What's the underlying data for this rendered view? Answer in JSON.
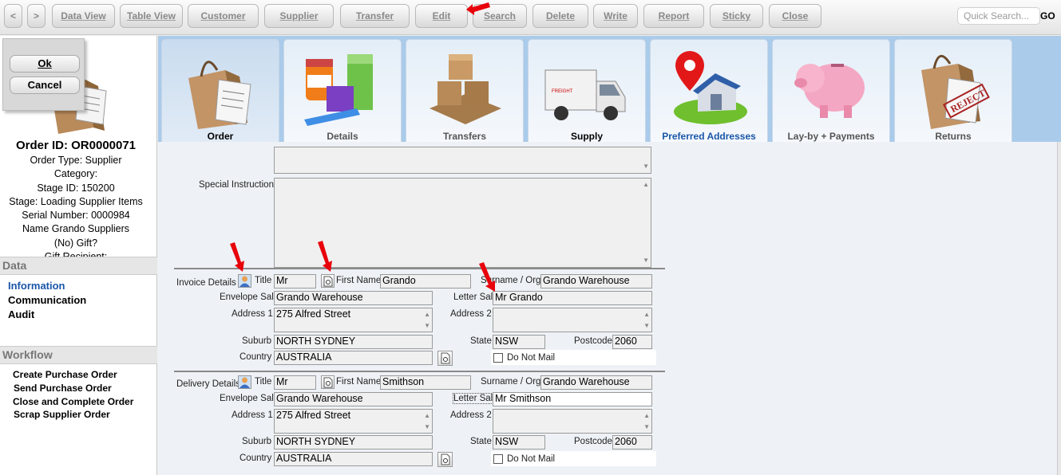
{
  "toolbar": {
    "back": "<",
    "forward": ">",
    "buttons": [
      "Data View",
      "Table View",
      "Customer",
      "Supplier",
      "Transfer",
      "Edit",
      "Search",
      "Delete",
      "Write",
      "Report",
      "Sticky",
      "Close"
    ],
    "quick_search_placeholder": "Quick Search...",
    "go": "GO"
  },
  "dialog": {
    "ok": "Ok",
    "cancel": "Cancel"
  },
  "order": {
    "id": "Order ID: OR0000071",
    "lines": [
      "Order Type: Supplier",
      "Category:",
      "Stage ID: 150200",
      "Stage: Loading Supplier Items",
      "Serial Number: 0000984",
      "Name Grando Suppliers",
      "(No) Gift?",
      "Gift Recipient:"
    ]
  },
  "data_section": {
    "title": "Data",
    "items": [
      "Information",
      "Communication",
      "Audit"
    ]
  },
  "workflow_section": {
    "title": "Workflow",
    "items": [
      "Create Purchase Order",
      "Send Purchase Order",
      "Close and Complete Order",
      "Scrap Supplier Order"
    ]
  },
  "tabs": [
    {
      "label": "Order",
      "icon": "shopping-bag-icon"
    },
    {
      "label": "Details",
      "icon": "products-icon"
    },
    {
      "label": "Transfers",
      "icon": "pallet-boxes-icon"
    },
    {
      "label": "Supply",
      "icon": "delivery-truck-icon"
    },
    {
      "label": "Preferred Addresses",
      "icon": "house-pin-icon"
    },
    {
      "label": "Lay-by + Payments",
      "icon": "piggy-bank-icon"
    },
    {
      "label": "Returns",
      "icon": "reject-bag-icon"
    }
  ],
  "form": {
    "special_instructions_label": "Special Instructions",
    "invoice": {
      "section_label": "Invoice Details",
      "title_label": "Title",
      "title": "Mr",
      "first_name_label": "First Name",
      "first_name": "Grando",
      "surname_label": "Surname / Org",
      "surname": "Grando Warehouse",
      "envelope_sal_label": "Envelope Sal",
      "envelope_sal": "Grando Warehouse",
      "letter_sal_label": "Letter Sal",
      "letter_sal": "Mr Grando",
      "address1_label": "Address 1",
      "address1": "275 Alfred Street",
      "address2_label": "Address 2",
      "address2": "",
      "suburb_label": "Suburb",
      "suburb": "NORTH SYDNEY",
      "state_label": "State",
      "state": "NSW",
      "postcode_label": "Postcode",
      "postcode": "2060",
      "country_label": "Country",
      "country": "AUSTRALIA",
      "do_not_mail_label": "Do Not Mail"
    },
    "delivery": {
      "section_label": "Delivery Details",
      "title_label": "Title",
      "title": "Mr",
      "first_name_label": "First Name",
      "first_name": "Smithson",
      "surname_label": "Surname / Org",
      "surname": "Grando Warehouse",
      "envelope_sal_label": "Envelope Sal",
      "envelope_sal": "Grando Warehouse",
      "letter_sal_label": "Letter Sal",
      "letter_sal": "Mr Smithson",
      "address1_label": "Address 1",
      "address1": "275 Alfred Street",
      "address2_label": "Address 2",
      "address2": "",
      "suburb_label": "Suburb",
      "suburb": "NORTH SYDNEY",
      "state_label": "State",
      "state": "NSW",
      "postcode_label": "Postcode",
      "postcode": "2060",
      "country_label": "Country",
      "country": "AUSTRALIA",
      "do_not_mail_label": "Do Not Mail"
    }
  },
  "colors": {
    "tab_bar": "#aacbea",
    "active_link": "#1a56a8",
    "annotation_arrow": "#e8000b"
  }
}
